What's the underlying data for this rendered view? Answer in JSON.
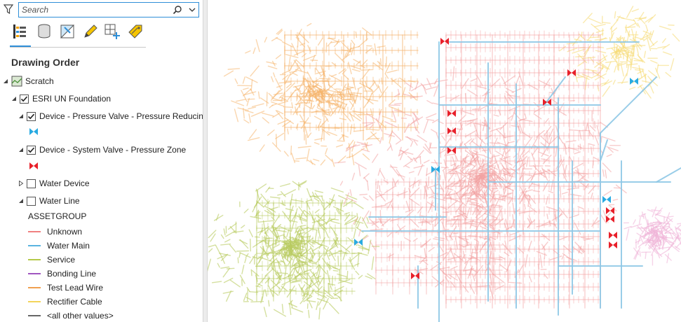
{
  "search": {
    "placeholder": "Search"
  },
  "heading": "Drawing Order",
  "layers": {
    "scratch": "Scratch",
    "foundation": "ESRI UN Foundation",
    "pressure_valve": "Device - Pressure Valve - Pressure Reducing",
    "system_valve": "Device - System Valve - Pressure Zone",
    "water_device": "Water Device",
    "water_line": "Water Line"
  },
  "legend": {
    "title": "ASSETGROUP",
    "items": [
      {
        "label": "Unknown",
        "color": "#f08080"
      },
      {
        "label": "Water Main",
        "color": "#5ab4e0"
      },
      {
        "label": "Service",
        "color": "#b5c94a"
      },
      {
        "label": "Bonding Line",
        "color": "#a055c0"
      },
      {
        "label": "Test Lead Wire",
        "color": "#f0a050"
      },
      {
        "label": "Rectifier Cable",
        "color": "#f3d45a"
      },
      {
        "label": "<all other values>",
        "color": "#666666"
      }
    ]
  },
  "colors": {
    "accent": "#2f8fd8",
    "pressure_valve_symbol": "#29abe2",
    "system_valve_symbol": "#e8202a"
  },
  "icons": [
    "filter-icon",
    "search-icon",
    "chevron-down-icon",
    "list-by-drawing-order-icon",
    "list-by-source-icon",
    "list-by-selection-icon",
    "list-by-editing-icon",
    "list-by-snapping-icon",
    "list-by-labeling-icon"
  ]
}
